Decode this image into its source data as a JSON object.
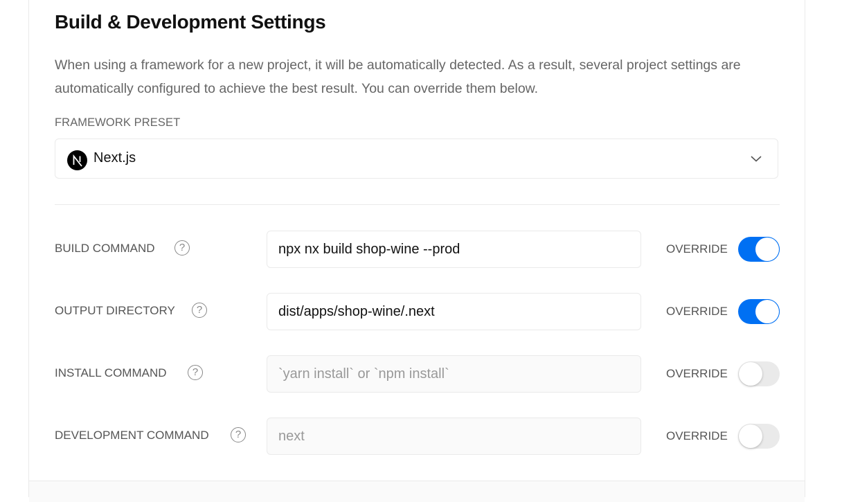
{
  "section": {
    "title": "Build & Development Settings",
    "description": "When using a framework for a new project, it will be automatically detected. As a result, several project settings are automatically configured to achieve the best result. You can override them below."
  },
  "framework_preset": {
    "label": "FRAMEWORK PRESET",
    "selected": "Next.js",
    "logo_letter": "N",
    "logo_icon": "nextjs-logo-icon",
    "chevron_icon": "chevron-down-icon"
  },
  "settings": [
    {
      "label": "BUILD COMMAND",
      "value": "npx nx build shop-wine --prod",
      "placeholder": "",
      "override_label": "OVERRIDE",
      "override": true,
      "help_icon": "question-circle-icon"
    },
    {
      "label": "OUTPUT DIRECTORY",
      "value": "dist/apps/shop-wine/.next",
      "placeholder": "",
      "override_label": "OVERRIDE",
      "override": true,
      "help_icon": "question-circle-icon"
    },
    {
      "label": "INSTALL COMMAND",
      "value": "",
      "placeholder": "`yarn install` or `npm install`",
      "override_label": "OVERRIDE",
      "override": false,
      "help_icon": "question-circle-icon"
    },
    {
      "label": "DEVELOPMENT COMMAND",
      "value": "",
      "placeholder": "next",
      "override_label": "OVERRIDE",
      "override": false,
      "help_icon": "question-circle-icon"
    }
  ],
  "colors": {
    "accent": "#0070f3",
    "toggle_off": "#eaeaea",
    "border": "#eaeaea",
    "muted_text": "#666666"
  }
}
